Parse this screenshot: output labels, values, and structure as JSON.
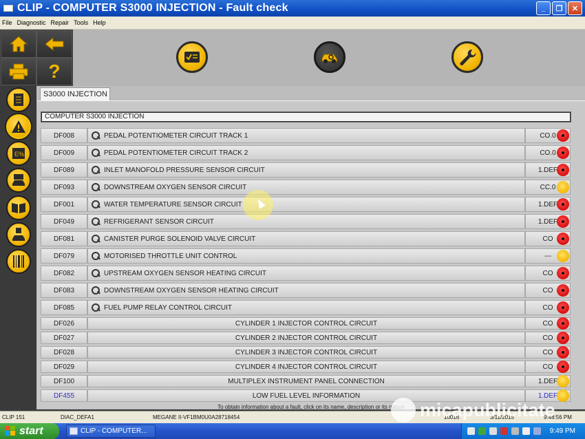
{
  "window": {
    "title": "CLIP - COMPUTER S3000 INJECTION - Fault check",
    "buttons": [
      "_",
      "❐",
      "✕"
    ]
  },
  "menu": [
    "File",
    "Diagnostic",
    "Repair",
    "Tools",
    "Help"
  ],
  "left_buttons": [
    "home-icon",
    "back-arrow-icon",
    "printer-icon",
    "help-icon"
  ],
  "left_help_glyph": "?",
  "side_icons": [
    "document-icon",
    "warning-icon",
    "parameters-icon",
    "vehicle-test-icon",
    "manual-icon",
    "vehicle-config-icon",
    "barcode-icon"
  ],
  "toolbar_icons": [
    "checklist-icon",
    "vehicle-diagnostic-icon",
    "wrench-icon"
  ],
  "tab": {
    "label": "S3000 INJECTION"
  },
  "section": {
    "label": "COMPUTER S3000 INJECTION"
  },
  "faults": [
    {
      "code": "DF008",
      "desc": "PEDAL POTENTIOMETER CIRCUIT TRACK 1",
      "status": "CO.0",
      "led": "red",
      "mag": true
    },
    {
      "code": "DF009",
      "desc": "PEDAL POTENTIOMETER CIRCUIT TRACK 2",
      "status": "CO.0",
      "led": "red",
      "mag": true
    },
    {
      "code": "DF089",
      "desc": "INLET MANOFOLD PRESSURE SENSOR CIRCUIT",
      "status": "1.DEF",
      "led": "red",
      "mag": true
    },
    {
      "code": "DF093",
      "desc": "DOWNSTREAM OXYGEN SENSOR CIRCUIT",
      "status": "CC.0",
      "led": "yellow",
      "mag": true
    },
    {
      "code": "DF001",
      "desc": "WATER TEMPERATURE SENSOR CIRCUIT",
      "status": "1.DEF",
      "led": "red",
      "mag": true
    },
    {
      "code": "DF049",
      "desc": "REFRIGERANT SENSOR CIRCUIT",
      "status": "1.DEF",
      "led": "red",
      "mag": true
    },
    {
      "code": "DF081",
      "desc": "CANISTER PURGE SOLENOID VALVE CIRCUIT",
      "status": "CO",
      "led": "red",
      "mag": true
    },
    {
      "code": "DF079",
      "desc": "MOTORISED THROTTLE UNIT CONTROL",
      "status": "---",
      "led": "yellow",
      "mag": true
    },
    {
      "code": "DF082",
      "desc": "UPSTREAM OXYGEN SENSOR HEATING CIRCUIT",
      "status": "CO",
      "led": "red",
      "mag": true
    },
    {
      "code": "DF083",
      "desc": "DOWNSTREAM OXYGEN SENSOR HEATING CIRCUIT",
      "status": "CO",
      "led": "red",
      "mag": true
    },
    {
      "code": "DF085",
      "desc": "FUEL PUMP RELAY CONTROL CIRCUIT",
      "status": "CO",
      "led": "red",
      "mag": true
    },
    {
      "code": "DF026",
      "desc": "CYLINDER 1 INJECTOR CONTROL CIRCUIT",
      "status": "CO",
      "led": "red",
      "mag": false
    },
    {
      "code": "DF027",
      "desc": "CYLINDER 2 INJECTOR CONTROL CIRCUIT",
      "status": "CO",
      "led": "red",
      "mag": false
    },
    {
      "code": "DF028",
      "desc": "CYLINDER 3 INJECTOR CONTROL CIRCUIT",
      "status": "CO",
      "led": "red",
      "mag": false
    },
    {
      "code": "DF029",
      "desc": "CYLINDER 4 INJECTOR CONTROL CIRCUIT",
      "status": "CO",
      "led": "red",
      "mag": false
    },
    {
      "code": "DF100",
      "desc": "MULTIPLEX INSTRUMENT PANEL CONNECTION",
      "status": "1.DEF",
      "led": "yellow",
      "mag": false
    },
    {
      "code": "DF455",
      "desc": "LOW FUEL LEVEL INFORMATION",
      "status": "1.DEF",
      "led": "yellow",
      "mag": false,
      "highlight": true
    }
  ],
  "footer_hint": "To obtain information about a fault, click on its name, description or its nature",
  "statusbar": {
    "version": "CLIP 151",
    "diag": "DIAC_DEFA1",
    "vehicle": "MEGANE II-VF1BM0U0A28718454",
    "num": "10016",
    "date": "3/11/2015",
    "time": "9:48:56 PM"
  },
  "taskbar": {
    "start": "start",
    "task": "CLIP - COMPUTER...",
    "clock": "9:49 PM"
  },
  "watermark": "micapublicitate",
  "colors": {
    "red_led": "#d80f0f",
    "yellow_led": "#f3b800",
    "accent": "#f0b400"
  }
}
